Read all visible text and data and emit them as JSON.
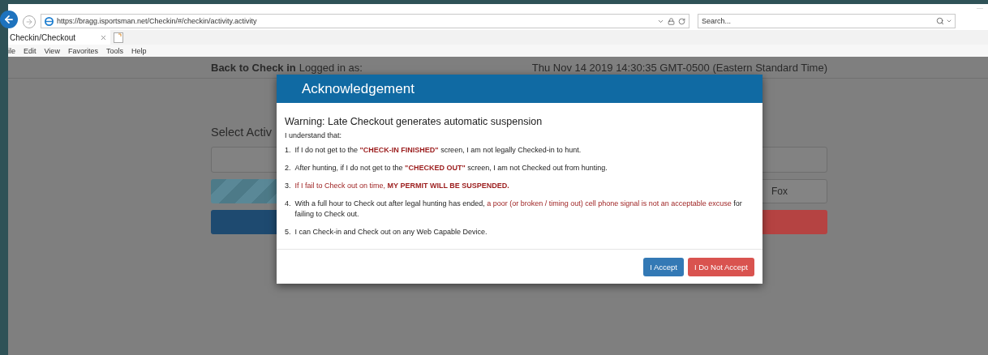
{
  "browser": {
    "address": "https://bragg.isportsman.net/Checkin/#/checkin/activity.activity",
    "search": {
      "placeholder": "Search..."
    },
    "tabs": [
      {
        "label": "Checkin/Checkout",
        "selected": true
      }
    ],
    "menu": [
      "ile",
      "Edit",
      "View",
      "Favorites",
      "Tools",
      "Help"
    ]
  },
  "page": {
    "back_link": "Back to Check in",
    "logged_in": "Logged in as:",
    "datetime": "Thu Nov 14 2019 14:30:35 GMT-0500 (Eastern Standard Time)",
    "heading": "Select Activ",
    "option_button": "Fox"
  },
  "modal": {
    "title": "Acknowledgement",
    "warning": "Warning: Late Checkout generates automatic suspension",
    "intro": "I understand that:",
    "items": [
      {
        "number": "1.",
        "segments": [
          {
            "text": "If I do not get to the ",
            "alert": false,
            "bold": false
          },
          {
            "text": "\"CHECK-IN FINISHED\"",
            "alert": true,
            "bold": true
          },
          {
            "text": " screen, I am not legally Checked-in to hunt.",
            "alert": false,
            "bold": false
          }
        ]
      },
      {
        "number": "2.",
        "segments": [
          {
            "text": "After hunting, if I do not get to the ",
            "alert": false,
            "bold": false
          },
          {
            "text": "\"CHECKED OUT\"",
            "alert": true,
            "bold": true
          },
          {
            "text": " screen, I am not Checked out from hunting.",
            "alert": false,
            "bold": false
          }
        ]
      },
      {
        "number": "3.",
        "segments": [
          {
            "text": "If I fail to Check out on time, ",
            "alert": true,
            "bold": false
          },
          {
            "text": "MY PERMIT WILL BE SUSPENDED.",
            "alert": true,
            "bold": true
          }
        ]
      },
      {
        "number": "4.",
        "segments": [
          {
            "text": "With a full hour to Check out after legal hunting has ended, ",
            "alert": false,
            "bold": false
          },
          {
            "text": "a poor (or broken / timing out) cell phone signal is not an acceptable excuse",
            "alert": true,
            "bold": false
          },
          {
            "text": " for failing to Check out.",
            "alert": false,
            "bold": false
          }
        ]
      },
      {
        "number": "5.",
        "segments": [
          {
            "text": "I can Check-in and Check out on any Web Capable Device.",
            "alert": false,
            "bold": false
          }
        ]
      }
    ],
    "buttons": [
      {
        "label": "I Accept",
        "kind": "primary"
      },
      {
        "label": "I Do Not Accept",
        "kind": "danger"
      }
    ]
  }
}
